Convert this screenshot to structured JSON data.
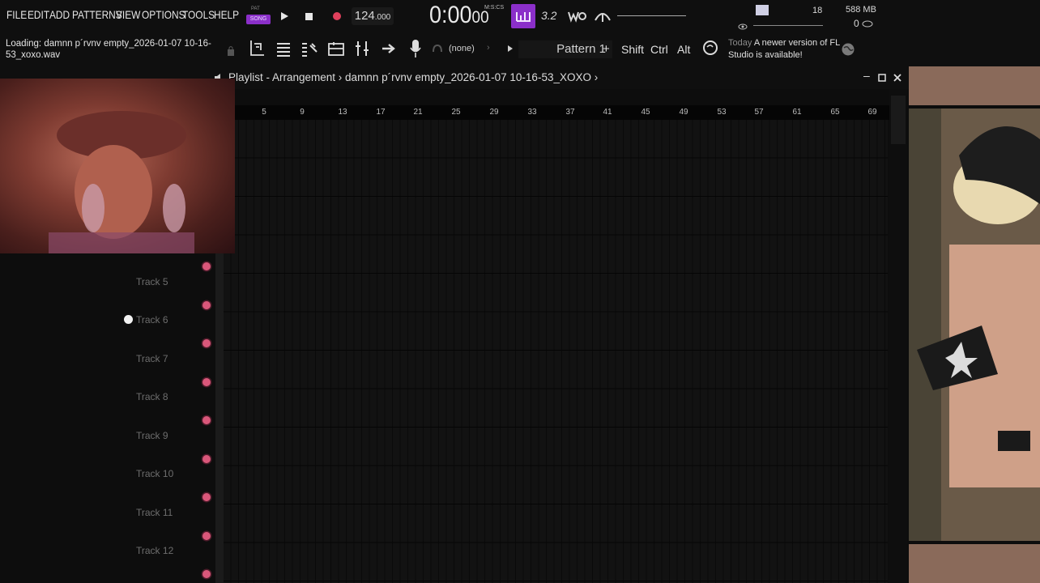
{
  "menu": [
    "FILE",
    "EDIT",
    "ADD",
    "PATTERNS",
    "VIEW",
    "OPTIONS",
    "TOOLS",
    "HELP"
  ],
  "loading_text": "Loading: damnn p´rvnv empty_2026-01-07 10-16-53_xoxo.wav",
  "transport": {
    "pat_label": "PAT",
    "song_label": "SONG",
    "bpm_main": "124",
    "bpm_frac": ".000",
    "time_main": "0:00",
    "time_frac": "00",
    "time_unit": "M:S:CS",
    "snap_label": "3.2"
  },
  "status": {
    "cpu_value": "18",
    "memory": "588 MB",
    "polyphony": "0"
  },
  "toolbar": {
    "none_label": "(none)",
    "pattern_label": "Pattern 1",
    "plus_label": "+",
    "shift_label": "Shift",
    "ctrl_label": "Ctrl",
    "alt_label": "Alt"
  },
  "news": {
    "today": "Today",
    "message": "A newer version of FL Studio is available!"
  },
  "playlist": {
    "breadcrumb": "Playlist - Arrangement › damnn p´rvnv empty_2026-01-07 10-16-53_XOXO ›",
    "ruler_ticks": [
      "5",
      "9",
      "13",
      "17",
      "21",
      "25",
      "29",
      "33",
      "37",
      "41",
      "45",
      "49",
      "53",
      "57",
      "61",
      "65",
      "69"
    ],
    "tracks": [
      "Track 5",
      "Track 6",
      "Track 7",
      "Track 8",
      "Track 9",
      "Track 10",
      "Track 11",
      "Track 12"
    ]
  },
  "colors": {
    "accent": "#8b2fc9",
    "track_dot": "#d9577a",
    "record": "#e0405c"
  }
}
